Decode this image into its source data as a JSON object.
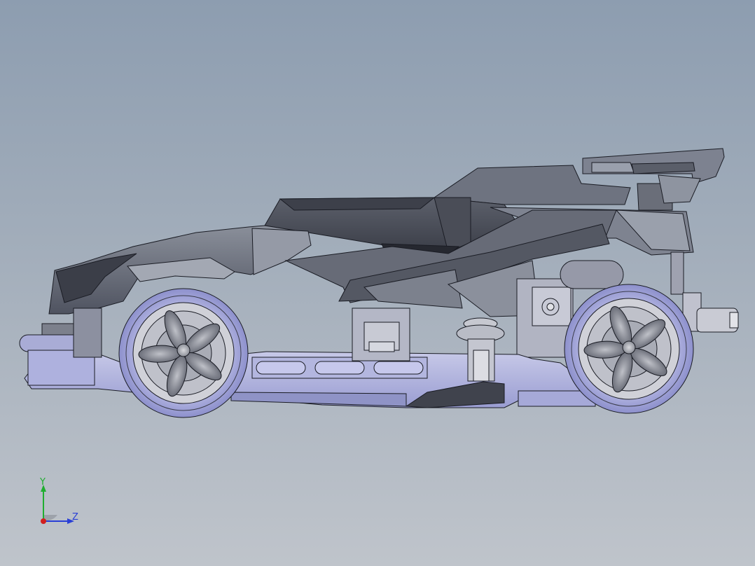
{
  "viewport": {
    "background_top": "#8d9db0",
    "background_bottom": "#bfc4cb"
  },
  "model": {
    "description_icon": "car-model-3d",
    "body_color": "#6f7582",
    "wheel_color": "#a8abdf",
    "edge_color": "#1a1c24"
  },
  "triad": {
    "y_label": "Y",
    "z_label": "Z",
    "y_color": "#1fae2f",
    "z_color": "#2a3fd6",
    "x_color": "#d11f1f"
  }
}
